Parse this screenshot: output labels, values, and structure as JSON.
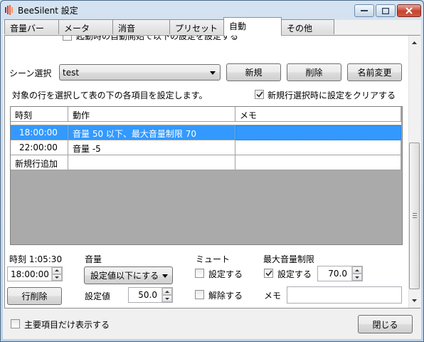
{
  "window": {
    "title": "BeeSilent 設定"
  },
  "tabs": [
    "音量バー",
    "メータ",
    "消音",
    "プリセット",
    "自動",
    "その他"
  ],
  "active_tab": "自動",
  "cut_text": "起動時の自動開始で以下の設定を設定する",
  "scene": {
    "label": "シーン選択",
    "value": "test",
    "new_label": "新規",
    "delete_label": "削除",
    "rename_label": "名前変更"
  },
  "instruction": "対象の行を選択して表の下の各項目を設定します。",
  "clear_on_new": {
    "label": "新規行選択時に設定をクリアする",
    "checked": true
  },
  "table": {
    "headers": [
      "時刻",
      "動作",
      "メモ"
    ],
    "rows": [
      {
        "time": "18:00:00",
        "action": "音量 50 以下、最大音量制限 70",
        "memo": "",
        "selected": true
      },
      {
        "time": "22:00:00",
        "action": "音量 -5",
        "memo": ""
      },
      {
        "time": "新規行追加",
        "action": "",
        "memo": ""
      }
    ]
  },
  "time_section": {
    "label": "時刻 1:05:30",
    "value": "18:00:00",
    "delete_row_label": "行削除"
  },
  "volume_section": {
    "label": "音量",
    "mode_value": "設定値以下にする",
    "setting_label": "設定値",
    "setting_value": "50.0"
  },
  "mute_section": {
    "label": "ミュート",
    "set_label": "設定する",
    "set_checked": false,
    "release_label": "解除する",
    "release_checked": false
  },
  "max_volume_section": {
    "label": "最大音量制限",
    "set_label": "設定する",
    "set_checked": true,
    "value": "70.0",
    "memo_label": "メモ",
    "memo_value": ""
  },
  "footer": {
    "main_only_label": "主要項目だけ表示する",
    "main_only_checked": false,
    "close_label": "閉じる"
  },
  "colors": {
    "selection": "#3399ff",
    "selection_border": "#1e6fd0"
  }
}
